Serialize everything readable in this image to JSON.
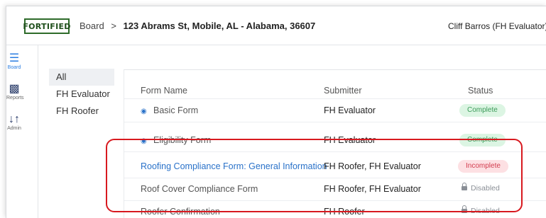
{
  "header": {
    "logo_text": "FORTIFIED",
    "breadcrumb_root": "Board",
    "breadcrumb_separator": ">",
    "breadcrumb_current": "123 Abrams St, Mobile, AL - Alabama, 36607",
    "user_label": "Cliff Barros (FH Evaluator)"
  },
  "rail": {
    "items": [
      {
        "label": "Board",
        "icon": "dashboard-list-icon"
      },
      {
        "label": "Reports",
        "icon": "bar-chart-icon"
      },
      {
        "label": "Admin",
        "icon": "sliders-icon"
      }
    ]
  },
  "filters": [
    "All",
    "FH Evaluator",
    "FH Roofer"
  ],
  "table": {
    "columns": [
      "Form Name",
      "Submitter",
      "Status"
    ],
    "rows": [
      {
        "name": "Basic Form",
        "submitter": "FH Evaluator",
        "status": "Complete",
        "viewable": true
      },
      {
        "name": "Eligibility Form",
        "submitter": "FH Evaluator",
        "status": "Complete",
        "viewable": true
      },
      {
        "name": "Roofing Compliance Form: General Information",
        "submitter": "FH Roofer, FH Evaluator",
        "status": "Incomplete",
        "viewable": false
      },
      {
        "name": "Roof Cover Compliance Form",
        "submitter": "FH Roofer, FH Evaluator",
        "status": "Disabled",
        "viewable": false
      },
      {
        "name": "Roofer Confirmation",
        "submitter": "FH Roofer",
        "status": "Disabled",
        "viewable": false
      }
    ]
  },
  "colors": {
    "link": "#2a72c9",
    "complete_bg": "#dcf5e3",
    "complete_text": "#3a9a58",
    "incomplete_bg": "#fde0e3",
    "incomplete_text": "#d23c4e",
    "highlight": "#d8191f",
    "logo_green": "#2e6b2a"
  }
}
